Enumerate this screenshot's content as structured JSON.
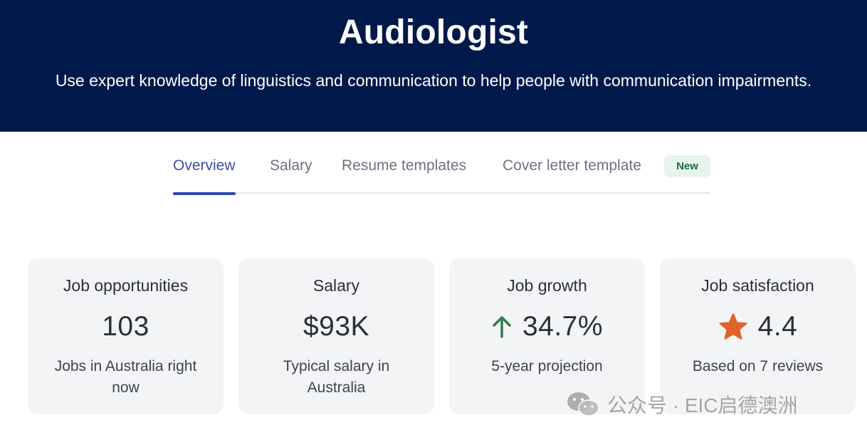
{
  "hero": {
    "title": "Audiologist",
    "subtitle": "Use expert knowledge of linguistics and communication to help people with communication impairments."
  },
  "tabs": [
    {
      "label": "Overview",
      "active": true
    },
    {
      "label": "Salary",
      "active": false
    },
    {
      "label": "Resume templates",
      "active": false
    },
    {
      "label": "Cover letter template",
      "active": false
    }
  ],
  "new_badge": "New",
  "cards": [
    {
      "title": "Job opportunities",
      "value": "103",
      "desc": "Jobs in Australia right now"
    },
    {
      "title": "Salary",
      "value": "$93K",
      "desc": "Typical salary in Australia"
    },
    {
      "title": "Job growth",
      "value": "34.7%",
      "desc": "5-year projection",
      "icon": "arrow-up-icon",
      "icon_color": "#2e7d4f"
    },
    {
      "title": "Job satisfaction",
      "value": "4.4",
      "desc": "Based on 7 reviews",
      "icon": "star-icon",
      "icon_color": "#e0622a"
    }
  ],
  "watermark": {
    "text": "公众号 · EIC启德澳洲",
    "icon": "wechat-icon"
  },
  "colors": {
    "hero_bg": "#00194a",
    "active_tab": "#2f47b0",
    "card_bg": "#f3f4f6"
  }
}
